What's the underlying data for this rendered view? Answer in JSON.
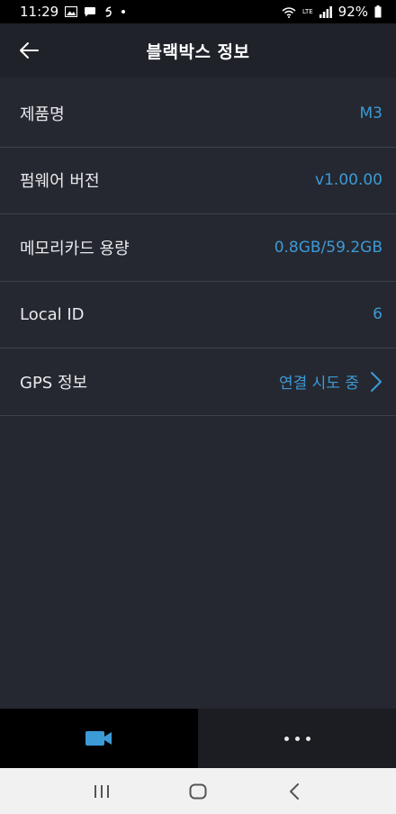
{
  "status_bar": {
    "time": "11:29",
    "battery": "92%",
    "network": "LTE"
  },
  "header": {
    "title": "블랙박스 정보"
  },
  "rows": [
    {
      "label": "제품명",
      "value": "M3"
    },
    {
      "label": "펌웨어 버전",
      "value": "v1.00.00"
    },
    {
      "label": "메모리카드 용량",
      "value": "0.8GB/59.2GB"
    },
    {
      "label": "Local ID",
      "value": "6"
    },
    {
      "label": "GPS 정보",
      "value": "연결 시도 중"
    }
  ],
  "tabs": [
    {
      "icon": "video-camera-icon",
      "active": true
    },
    {
      "icon": "more-dots-icon",
      "active": false
    }
  ],
  "nav": [
    "recent-apps-icon",
    "home-icon",
    "back-icon"
  ],
  "colors": {
    "accent": "#3c9ad6",
    "background": "#252830",
    "header": "#1f2228"
  }
}
